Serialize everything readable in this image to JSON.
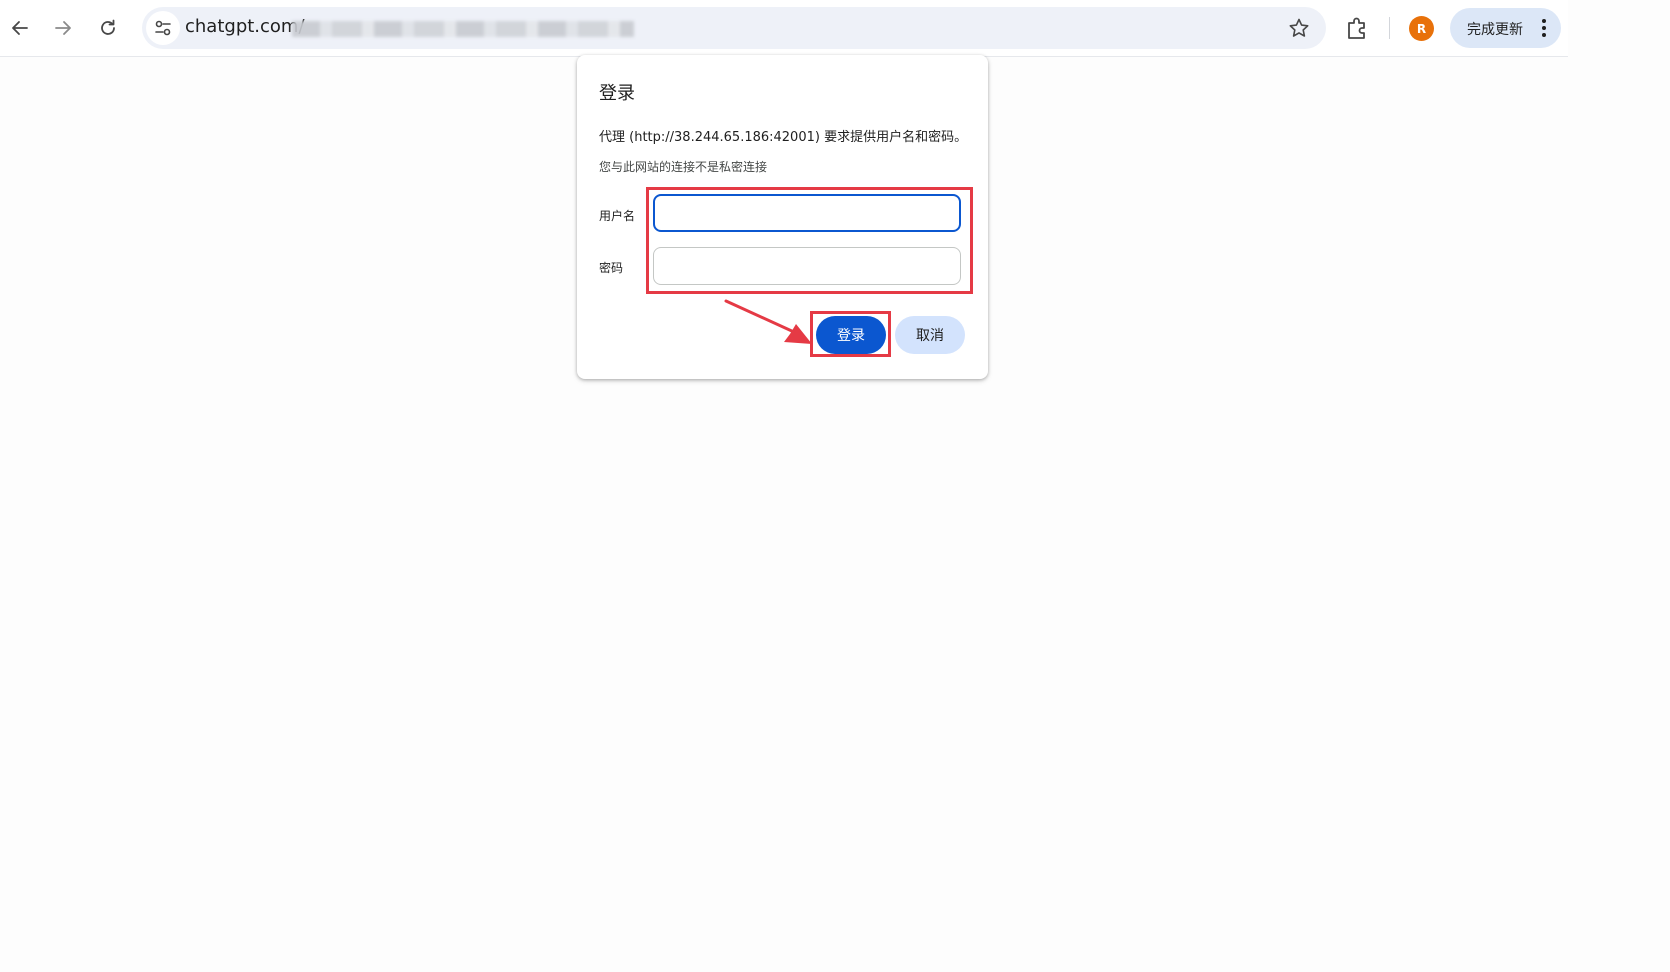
{
  "browser": {
    "url_text": "chatgpt.com/",
    "avatar_initial": "R",
    "update_label": "完成更新",
    "accent_color": "#0b57d0",
    "avatar_color": "#e8710a"
  },
  "dialog": {
    "title": "登录",
    "message": "代理 (http://38.244.65.186:42001) 要求提供用户名和密码。",
    "subtext": "您与此网站的连接不是私密连接",
    "username_label": "用户名",
    "username_value": "",
    "password_label": "密码",
    "password_value": "",
    "login_label": "登录",
    "cancel_label": "取消"
  },
  "annotations": {
    "highlight_color": "#e53a45"
  }
}
